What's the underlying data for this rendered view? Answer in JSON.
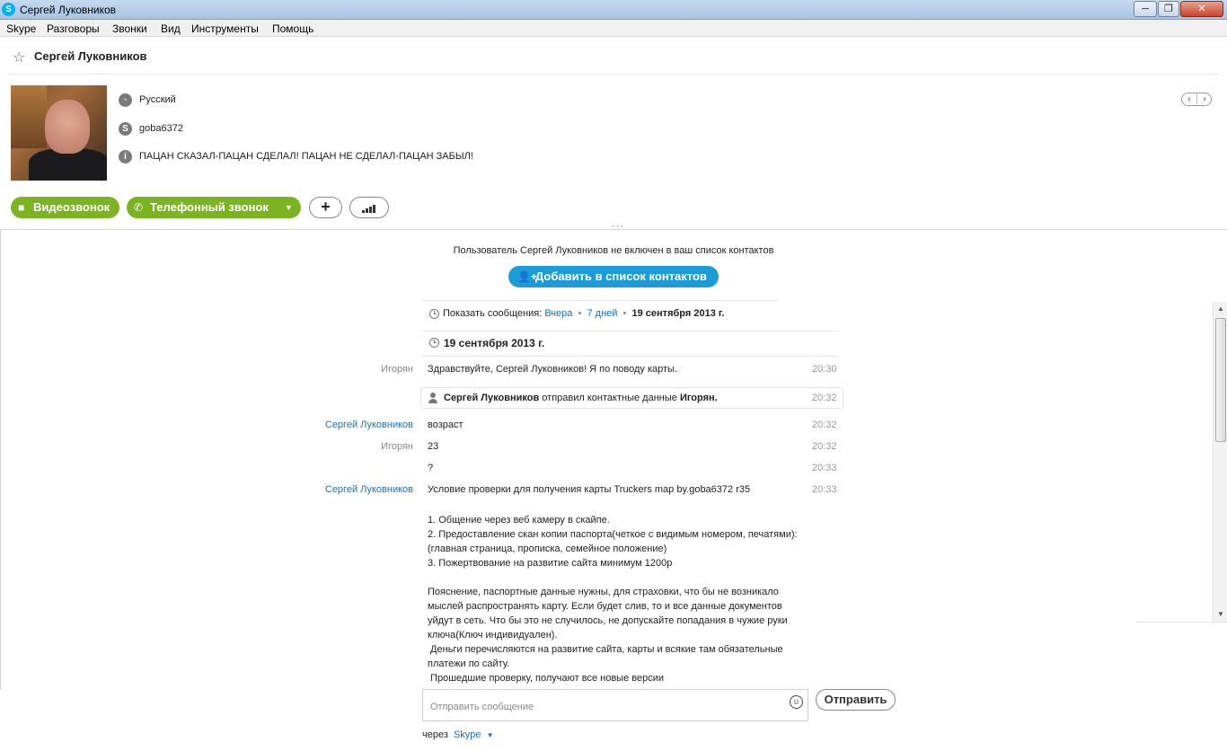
{
  "window": {
    "title": "Сергей Луковников",
    "min_glyph": "─",
    "max_glyph": "❐",
    "close_glyph": "✕"
  },
  "menu": [
    "Skype",
    "Разговоры",
    "Звонки",
    "Вид",
    "Инструменты",
    "Помощь"
  ],
  "contact": {
    "name": "Сергей Луковников",
    "language": "Русский",
    "skype_login": "goba6372",
    "mood": "ПАЦАН СКАЗАЛ-ПАЦАН СДЕЛАЛ! ПАЦАН НЕ СДЕЛАЛ-ПАЦАН ЗАБЫЛ!"
  },
  "actions": {
    "video_call": "Видеозвонок",
    "phone_call": "Телефонный звонок"
  },
  "notice": {
    "text": "Пользователь Сергей Луковников не включен в ваш список контактов",
    "add_button": "Добавить в список контактов"
  },
  "history": {
    "label": "Показать сообщения:",
    "options": [
      "Вчера",
      "7 дней"
    ],
    "current": "19 сентября 2013 г."
  },
  "date_header": "19 сентября 2013 г.",
  "messages": [
    {
      "author": "Игорян",
      "text": "Здравствуйте, Сергей Луковников! Я по поводу карты.",
      "time": "20:30"
    },
    {
      "author": "Сергей Луковников",
      "text": "возраст",
      "time": "20:32"
    },
    {
      "author": "Игорян",
      "text": "23",
      "time": "20:32"
    },
    {
      "author": "",
      "text": "?",
      "time": "20:33"
    },
    {
      "author": "Сергей Луковников",
      "text": "Условие проверки для получения карты Truckers map by.goba6372 r35",
      "time": "20:33"
    }
  ],
  "system_message": {
    "sender": "Сергей Луковников",
    "action": "отправил контактные данные",
    "target": "Игорян.",
    "time": "20:32"
  },
  "long_message": "1. Общение через веб камеру в скайпе.\n2. Предоставление скан копии паспорта(четкое с видимым номером, печатями):\n(главная страница, прописка, семейное положение)\n3. Пожертвование на развитие сайта минимум 1200р\n\nПояснение, паспортные данные нужны, для страховки, что бы не возникало\nмыслей распространять карту. Если будет слив, то и все данные документов\nуйдут в сеть. Что бы это не случилось, не допускайте попадания в чужие руки\nключа(Ключ индивидуален).\n Деньги перечисляются на развитие сайта, карты и всякие там обязательные\nплатежи по сайту.\n Прошедшие проверку, получают все новые версии",
  "compose": {
    "placeholder": "Отправить сообщение",
    "value": "",
    "send": "Отправить"
  },
  "via": {
    "label": "через",
    "service": "Skype"
  },
  "colors": {
    "green": "#7bb321",
    "blue": "#1c9cd6",
    "link": "#1a6fb5"
  }
}
